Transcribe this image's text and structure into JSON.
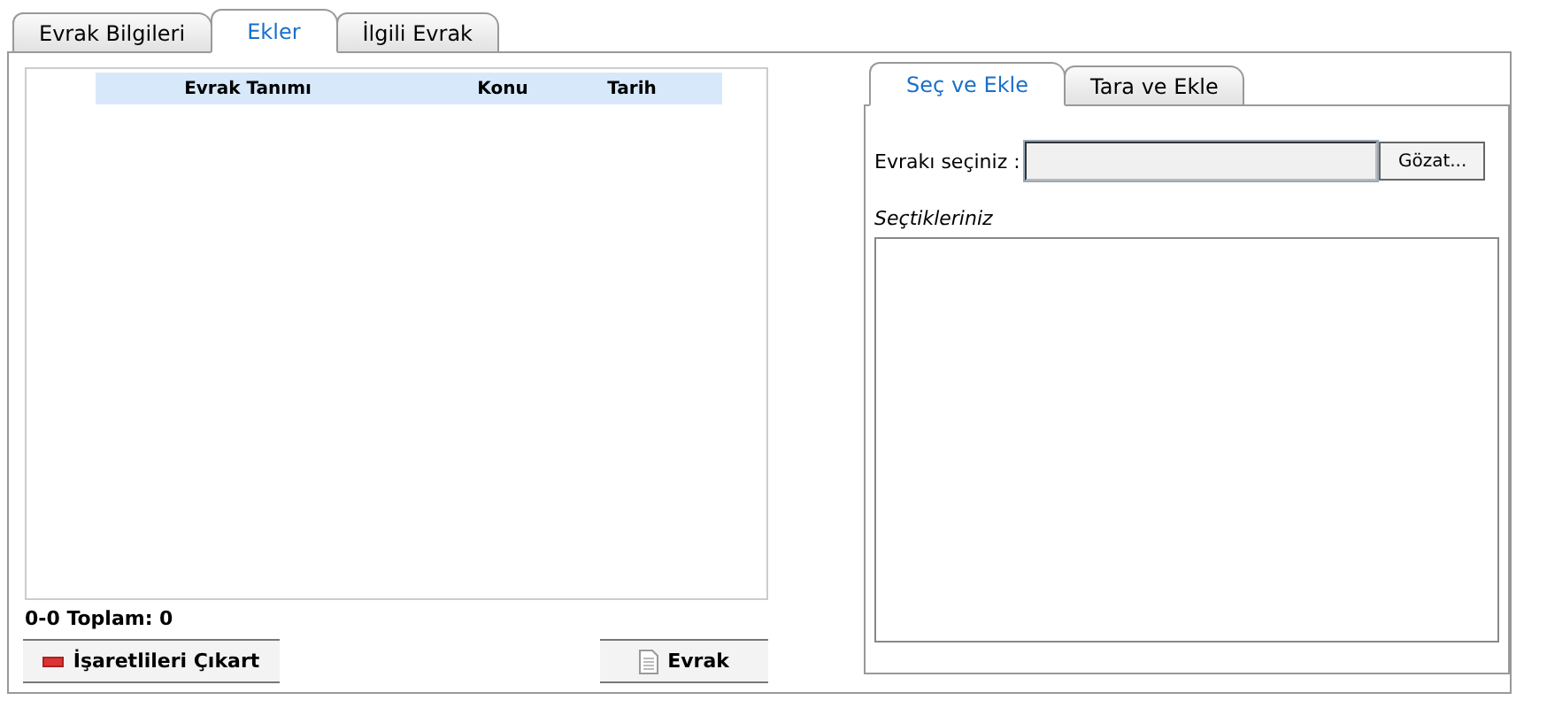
{
  "tabs": [
    {
      "label": "Evrak Bilgileri",
      "selected": false
    },
    {
      "label": "Ekler",
      "selected": true
    },
    {
      "label": "İlgili Evrak",
      "selected": false
    }
  ],
  "grid": {
    "columns": [
      "Evrak Tanımı",
      "Konu",
      "Tarih"
    ],
    "status": "0-0 Toplam: 0"
  },
  "left_buttons": [
    "İşaretlileri Çıkart",
    "Evrak"
  ],
  "sub_tabs": [
    {
      "label": "Seç ve Ekle",
      "selected": true
    },
    {
      "label": "Tara ve Ekle",
      "selected": false
    }
  ],
  "file_picker": {
    "label": "Evrakı seçiniz :",
    "button": "Gözat..."
  },
  "selected_list": {
    "label": "Seçtikleriniz"
  }
}
